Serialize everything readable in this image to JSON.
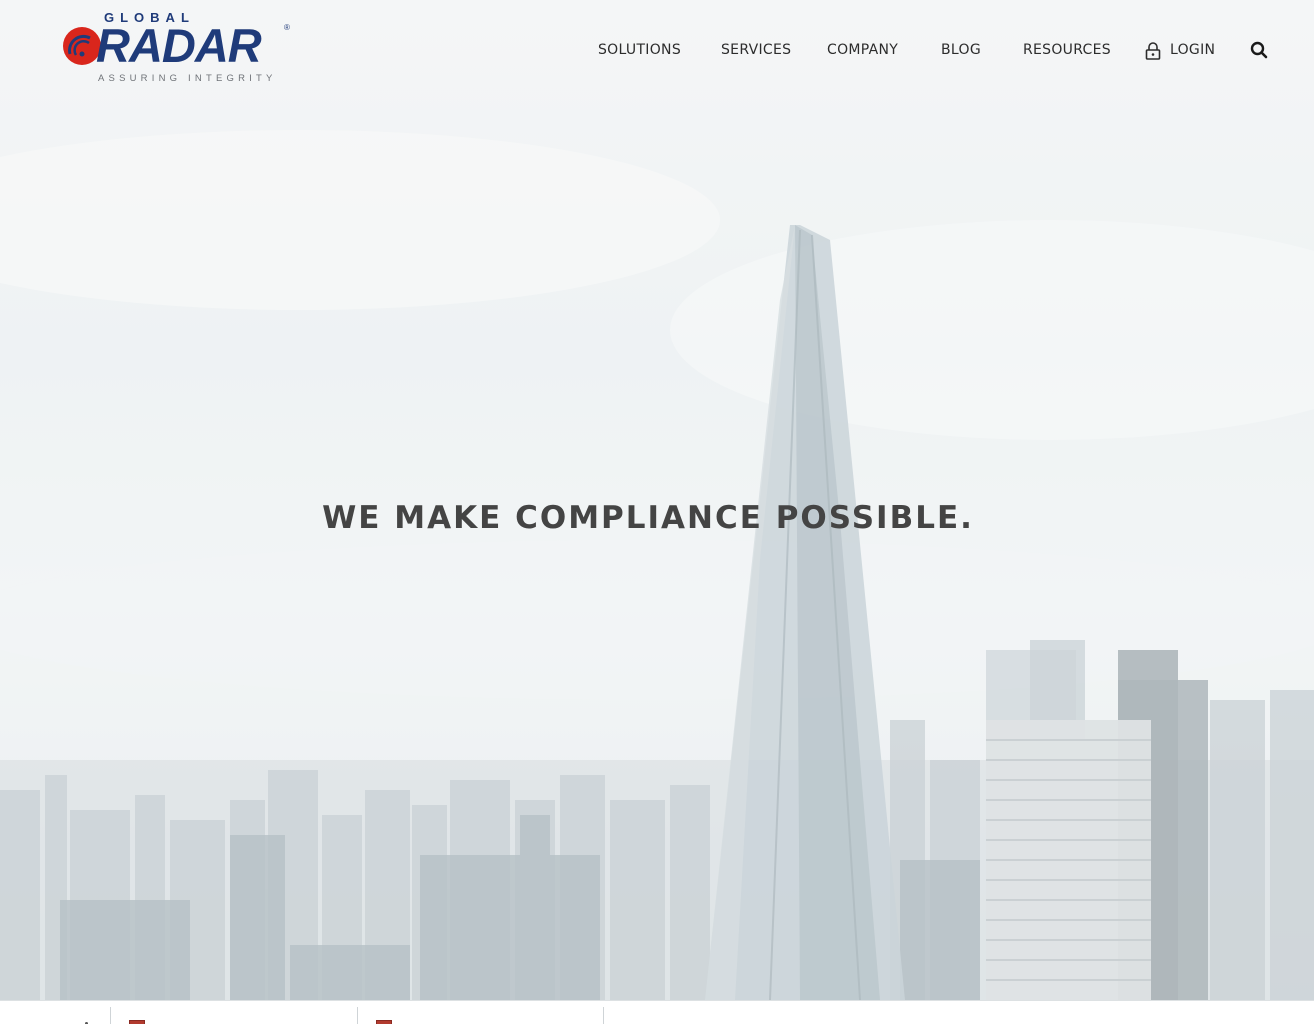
{
  "logo": {
    "top_word": "GLOBAL",
    "main_word": "RADAR",
    "registered": "®",
    "tagline": "ASSURING INTEGRITY"
  },
  "nav": {
    "items": [
      {
        "label": "SOLUTIONS"
      },
      {
        "label": "SERVICES"
      },
      {
        "label": "COMPANY"
      },
      {
        "label": "BLOG"
      },
      {
        "label": "RESOURCES"
      },
      {
        "label": "LOGIN"
      }
    ]
  },
  "hero": {
    "headline": "WE MAKE COMPLIANCE POSSIBLE."
  },
  "colors": {
    "brand_blue": "#1f3b7a",
    "brand_red": "#d9261c",
    "text_dark": "#2c2c2c"
  },
  "icons": {
    "login": "lock-icon",
    "search": "search-icon"
  }
}
